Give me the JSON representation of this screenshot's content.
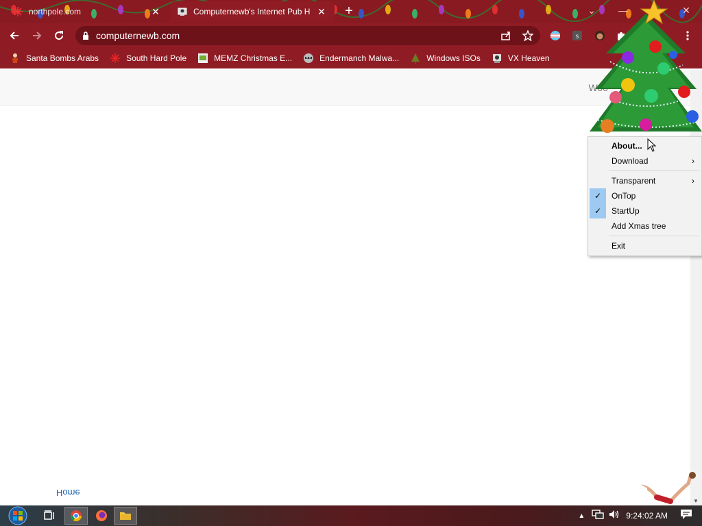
{
  "tabs": [
    {
      "title": "northpole.com",
      "active": false
    },
    {
      "title": "Computernewb's Internet Pub H",
      "active": true
    }
  ],
  "window_buttons": {
    "minimize": "—",
    "maximize": "☐",
    "close": "✕",
    "dropdown": "⌄"
  },
  "toolbar": {
    "url": "computernewb.com"
  },
  "bookmarks": [
    {
      "label": "Santa Bombs Arabs",
      "icon": "santa-icon"
    },
    {
      "label": "South Hard Pole",
      "icon": "snowflake-icon"
    },
    {
      "label": "MEMZ Christmas E...",
      "icon": "memz-icon"
    },
    {
      "label": "Endermanch Malwa...",
      "icon": "raccoon-icon"
    },
    {
      "label": "Windows ISOs",
      "icon": "tree-icon"
    },
    {
      "label": "VX Heaven",
      "icon": "vx-icon"
    }
  ],
  "page": {
    "header_text": "Woo",
    "home_link": "Home"
  },
  "context_menu": {
    "items": [
      {
        "label": "About...",
        "bold": true,
        "checked": false,
        "submenu": false
      },
      {
        "label": "Download",
        "bold": false,
        "checked": false,
        "submenu": true
      },
      {
        "label": "Transparent",
        "bold": false,
        "checked": false,
        "submenu": true
      },
      {
        "label": "OnTop",
        "bold": false,
        "checked": true,
        "submenu": false
      },
      {
        "label": "StartUp",
        "bold": false,
        "checked": true,
        "submenu": false
      },
      {
        "label": "Add Xmas tree",
        "bold": false,
        "checked": false,
        "submenu": false
      },
      {
        "label": "Exit",
        "bold": false,
        "checked": false,
        "submenu": false
      }
    ],
    "submenu_glyph": "›",
    "check_glyph": "✓"
  },
  "taskbar": {
    "clock": "9:24:02 AM"
  },
  "colors": {
    "chrome_red": "#8f1c24",
    "omnibox": "#6e121a",
    "menu_check": "#9ec9f0"
  }
}
